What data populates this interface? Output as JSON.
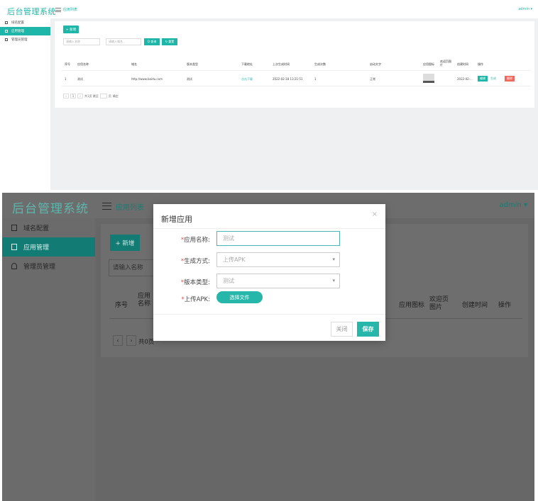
{
  "app": {
    "title": "后台管理系统",
    "breadcrumb": "应用列表",
    "user": "admin ▾"
  },
  "sidebar": {
    "items": [
      {
        "label": "域名配置",
        "icon": "clipboard-icon"
      },
      {
        "label": "应用管理",
        "icon": "clipboard-icon",
        "active": true
      },
      {
        "label": "管理员管理",
        "icon": "user-icon"
      }
    ]
  },
  "list": {
    "add_label": "+ 新增",
    "search_name_placeholder": "请输入名称",
    "search_url_placeholder": "请输入域名",
    "search_label": "Q 查询",
    "reset_label": "↻ 重置",
    "columns": [
      "序号",
      "应用名称",
      "域名",
      "版本类型",
      "下载地址",
      "上次生成时间",
      "生成次数",
      "启动文字",
      "应用图标",
      "欢迎页图片",
      "创建时间",
      "操作"
    ],
    "columns_s2": [
      "序号",
      "应用名称",
      "应用图标",
      "欢迎页图片",
      "创建时间",
      "操作"
    ],
    "rows": [
      {
        "index": "1",
        "name": "测试",
        "domain": "http://www.baidu.com",
        "version": "测试",
        "download": "点击下载",
        "last_time": "2022-02-18 13:21:51",
        "count": "1",
        "start_text": "正常",
        "created": "2022-02-...",
        "op_edit": "编辑",
        "op_regen": "生成",
        "op_delete": "删除"
      }
    ],
    "pager": {
      "prev": "‹",
      "page": "1",
      "next": "›",
      "info": "共1页 跳至",
      "page_suffix": "页",
      "confirm": "确定"
    },
    "pager_s2": {
      "info": "共0页"
    }
  },
  "modal": {
    "title": "新增应用",
    "close": "×",
    "fields": [
      {
        "label": "应用名称:",
        "value": "测试"
      },
      {
        "label": "生成方式:",
        "value": "上传APK"
      },
      {
        "label": "版本类型:",
        "value": "测试"
      },
      {
        "label": "上传APK:"
      }
    ],
    "file_btn": "选择文件",
    "cancel": "关闭",
    "save": "保存"
  },
  "colors": {
    "accent": "#1db6a8",
    "dark_accent": "#127b73",
    "required": "#e34d4d"
  }
}
